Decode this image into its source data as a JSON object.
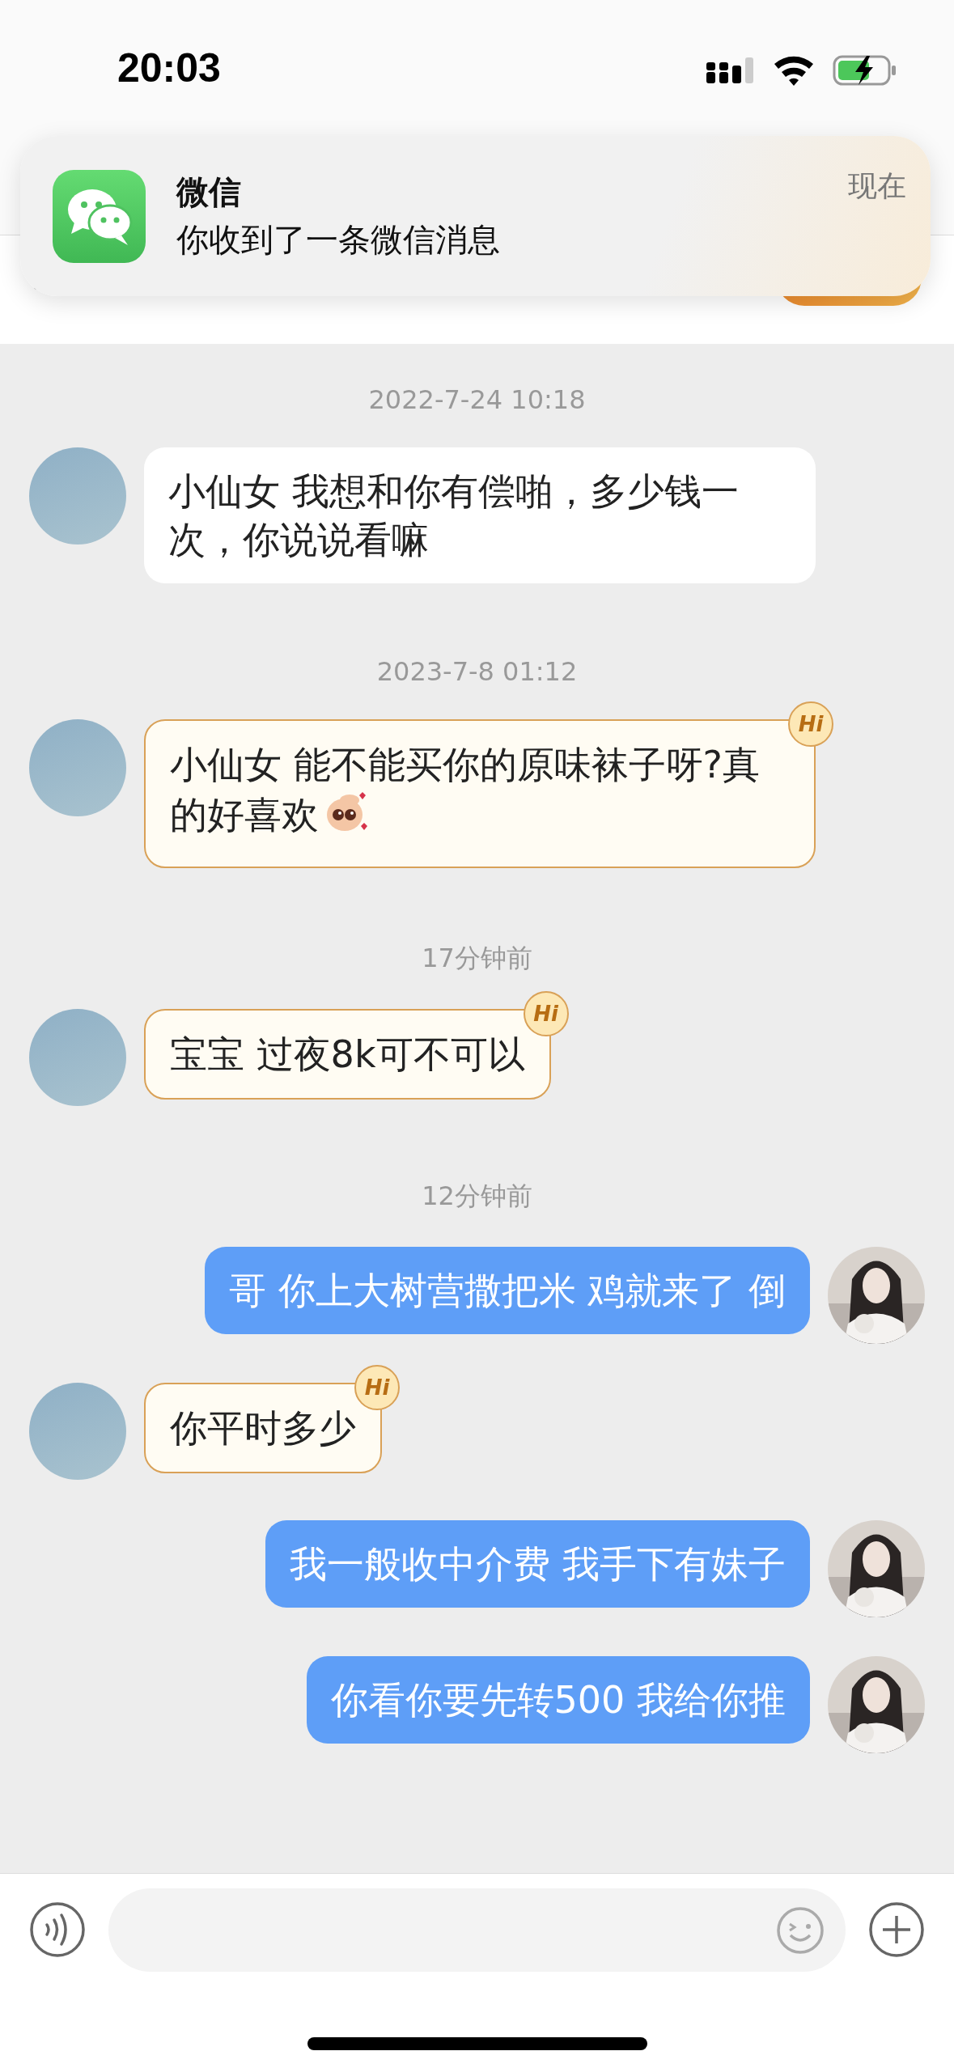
{
  "status_bar": {
    "time": "20:03"
  },
  "notification": {
    "app": "微信",
    "message": "你收到了一条微信消息",
    "time": "现在"
  },
  "messages": [
    {
      "kind": "timestamp",
      "text": "2022-7-24 10:18"
    },
    {
      "kind": "incoming",
      "text": "小仙女 我想和你有偿啪，多少钱一次，你说说看嘛"
    },
    {
      "kind": "timestamp",
      "text": "2023-7-8 01:12"
    },
    {
      "kind": "incoming",
      "text": "小仙女 能不能买你的原味袜子呀?真的好喜欢",
      "badge": "Hi",
      "sticker": true
    },
    {
      "kind": "timestamp",
      "text": "17分钟前"
    },
    {
      "kind": "incoming",
      "text": "宝宝 过夜8k可不可以",
      "badge": "Hi"
    },
    {
      "kind": "timestamp",
      "text": "12分钟前"
    },
    {
      "kind": "outgoing",
      "text": "哥 你上大树营撒把米 鸡就来了 倒"
    },
    {
      "kind": "incoming",
      "text": "你平时多少",
      "badge": "Hi"
    },
    {
      "kind": "outgoing",
      "text": "我一般收中介费 我手下有妹子"
    },
    {
      "kind": "outgoing",
      "text": "你看你要先转500 我给你推"
    }
  ]
}
